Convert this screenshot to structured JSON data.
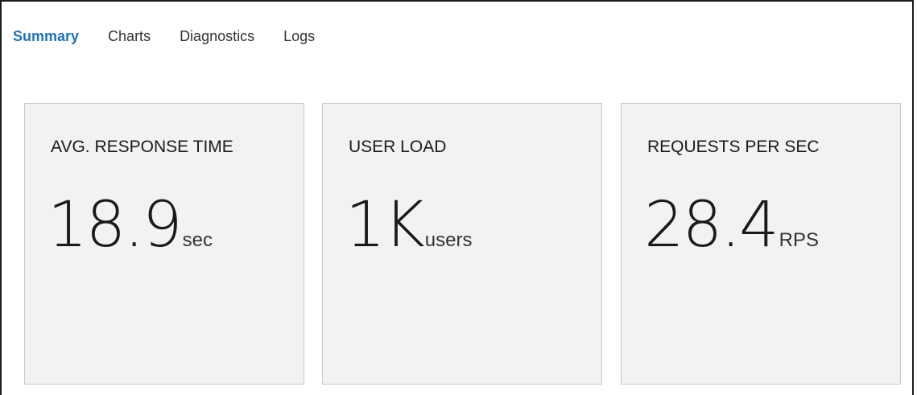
{
  "tabs": [
    {
      "label": "Summary",
      "active": true
    },
    {
      "label": "Charts",
      "active": false
    },
    {
      "label": "Diagnostics",
      "active": false
    },
    {
      "label": "Logs",
      "active": false
    }
  ],
  "cards": [
    {
      "title": "AVG. RESPONSE TIME",
      "value": "18.9",
      "unit": "sec"
    },
    {
      "title": "USER LOAD",
      "value": "1K",
      "unit": "users"
    },
    {
      "title": "REQUESTS PER SEC",
      "value": "28.4",
      "unit": "RPS"
    }
  ],
  "colors": {
    "accent": "#1e73be",
    "card_background": "#f2f2f2",
    "card_border": "#c8c8c8",
    "text": "#1a1a1a"
  }
}
